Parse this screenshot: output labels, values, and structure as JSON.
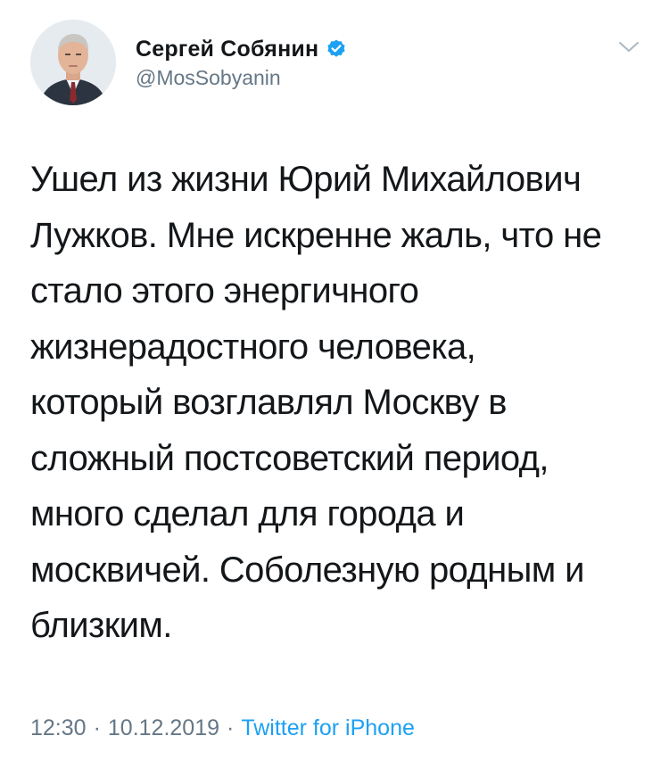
{
  "author": {
    "display_name": "Сергей Собянин",
    "handle": "@MosSobyanin",
    "verified": true,
    "avatar_icon": "profile-photo"
  },
  "tweet": {
    "lines": [
      "Ушел из жизни Юрий Михайлович",
      "Лужков. Мне искренне жаль, что не",
      "стало этого энергичного",
      "жизнерадостного человека,",
      "который возглавлял Москву в",
      "сложный постсоветский период,",
      "много сделал для города и",
      "москвичей. Соболезную родным и",
      "близким."
    ],
    "time": "12:30",
    "separator": "·",
    "date": "10.12.2019",
    "source": "Twitter for iPhone"
  },
  "colors": {
    "text": "#14171a",
    "muted": "#657786",
    "link": "#1da1f2",
    "verified_badge": "#1da1f2"
  },
  "icons": {
    "verified": "verified-badge-icon",
    "menu": "chevron-down-icon"
  }
}
